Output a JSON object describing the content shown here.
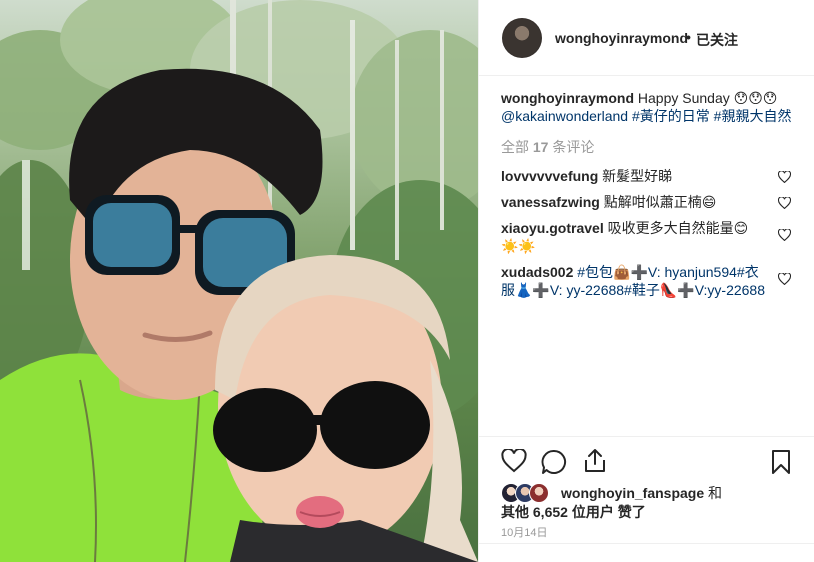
{
  "header": {
    "username": "wonghoyinraymond",
    "separator": "•",
    "follow_state": "已关注"
  },
  "caption": {
    "username": "wonghoyinraymond",
    "text": "Happy Sunday 😯😯😯",
    "mention": "@kakainwonderland",
    "hashtag1": "#黃仔的日常",
    "hashtag2": "#親親大自然"
  },
  "view_all_comments": {
    "prefix": "全部",
    "count": "17",
    "suffix": "条评论"
  },
  "comments": [
    {
      "username": "lovvvvvvefung",
      "text": "新髮型好睇"
    },
    {
      "username": "vanessafzwing",
      "text": "點解咁似蕭正楠😄"
    },
    {
      "username": "xiaoyu.gotravel",
      "text": "吸收更多大自然能量😊☀️☀️"
    },
    {
      "username": "xudads002",
      "text": "#包包👜➕V: hyanjun594#衣服👗➕V: yy-22688#鞋子👠➕V:yy-22688"
    }
  ],
  "likes": {
    "first_liker": "wonghoyin_fanspage",
    "and": "和",
    "others_prefix": "其他",
    "count": "6,652",
    "others_suffix": "位用户 赞了"
  },
  "date": "10月14日",
  "icons": {
    "like": "heart-icon",
    "comment": "comment-icon",
    "share": "share-icon",
    "save": "bookmark-icon",
    "comment_like": "heart-icon"
  },
  "colors": {
    "text": "#262626",
    "muted": "#999999",
    "link": "#003569",
    "divider": "#efefef"
  }
}
